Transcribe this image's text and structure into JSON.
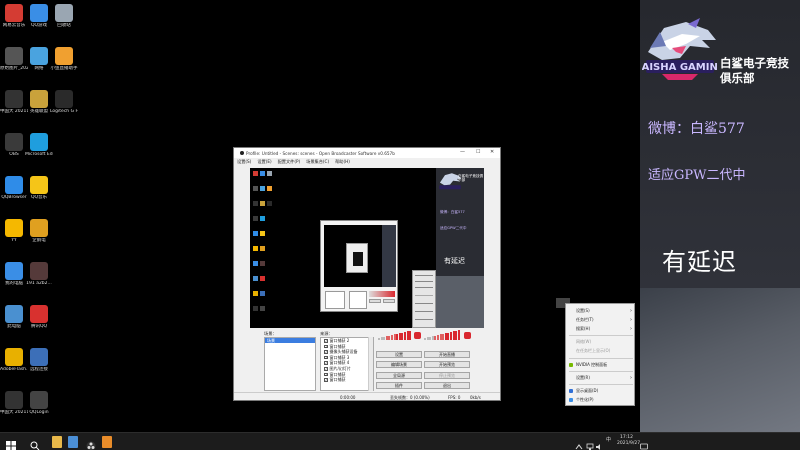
{
  "desktop": {
    "icons": [
      {
        "label": "网易云音乐",
        "color": "#d43c33",
        "col": 0,
        "row": 0
      },
      {
        "label": "QQ游戏",
        "color": "#3a8ee6",
        "col": 1,
        "row": 0
      },
      {
        "label": "回收站",
        "color": "#9aa6b2",
        "col": 2,
        "row": 0
      },
      {
        "label": "原始图片_20211...",
        "color": "#555",
        "col": 0,
        "row": 1
      },
      {
        "label": "网络",
        "color": "#4aa3df",
        "col": 1,
        "row": 1
      },
      {
        "label": "小鱼直播助手",
        "color": "#f0a030",
        "col": 2,
        "row": 1
      },
      {
        "label": "中国大 20211123...",
        "color": "#333",
        "col": 0,
        "row": 2
      },
      {
        "label": "英雄联盟",
        "color": "#c9a23b",
        "col": 1,
        "row": 2
      },
      {
        "label": "Logitech G HUB",
        "color": "#2a2a2a",
        "col": 2,
        "row": 2
      },
      {
        "label": "OBS",
        "color": "#3a3a3a",
        "col": 0,
        "row": 3
      },
      {
        "label": "Microsoft Edge",
        "color": "#1f9ede",
        "col": 1,
        "row": 3
      },
      {
        "label": "QQBrowser",
        "color": "#2f8ce8",
        "col": 0,
        "row": 4
      },
      {
        "label": "QQ音乐",
        "color": "#f5c518",
        "col": 1,
        "row": 4
      },
      {
        "label": "YY",
        "color": "#f5b800",
        "col": 0,
        "row": 5
      },
      {
        "label": "企鹅电",
        "color": "#e0a020",
        "col": 1,
        "row": 5
      },
      {
        "label": "我的电脑",
        "color": "#3a8ee6",
        "col": 0,
        "row": 6
      },
      {
        "label": "191 a2b2...",
        "color": "#553a3a",
        "col": 1,
        "row": 6
      },
      {
        "label": "此电脑",
        "color": "#4a90d0",
        "col": 0,
        "row": 7
      },
      {
        "label": "腾讯QQ",
        "color": "#d8312f",
        "col": 1,
        "row": 7
      },
      {
        "label": "AdobeFlash...",
        "color": "#e8b000",
        "col": 0,
        "row": 8
      },
      {
        "label": "远程连接",
        "color": "#3c6fb8",
        "col": 1,
        "row": 8
      },
      {
        "label": "中国大 20211020...",
        "color": "#333",
        "col": 0,
        "row": 9
      },
      {
        "label": "QQLogin",
        "color": "#444",
        "col": 1,
        "row": 9
      }
    ]
  },
  "overlay": {
    "club_name": "白鲨电子竞技俱乐部",
    "weibo": "微博：白鲨577",
    "adapt": "适应GPW二代中",
    "delay": "有延迟",
    "logo_text": "BAISHA GAMING"
  },
  "obs": {
    "title": "Profile: Untitled - Scenes: scenes - Open Broadcaster Software v0.657b",
    "menu": [
      "设置(S)",
      "设置(E)",
      "配置文件(P)",
      "场景集合(C)",
      "帮助(H)"
    ],
    "preview_delay": "有延迟",
    "scenes_label": "场景：",
    "sources_label": "来源：",
    "scene_selected": "场景",
    "sources": [
      "窗口捕获 2",
      "窗口捕获",
      "摄像头捕获设备",
      "窗口捕获 3",
      "窗口捕获 4",
      "图片/幻灯片",
      "窗口捕获",
      "窗口捕获"
    ],
    "buttons": {
      "settings": "设置",
      "start_stream": "开始直播",
      "edit_scene": "编辑场景",
      "start_preview": "开始预览",
      "global_sources": "全局源",
      "plugins": "插件",
      "exit": "退出",
      "studio_mode": "停止预览"
    },
    "status": {
      "time": "0:00:00",
      "dropped": "丢失帧数：0 (0.00%)",
      "fps": "FPS: 0",
      "kbps": "0kb/s"
    }
  },
  "context_menu": {
    "items": [
      {
        "label": "设置(S)",
        "type": "submenu",
        "enabled": true
      },
      {
        "label": "任务栏(T)",
        "type": "submenu",
        "enabled": true
      },
      {
        "label": "搜索(H)",
        "type": "submenu",
        "enabled": true
      },
      {
        "label": "网络(W)",
        "type": "item",
        "enabled": false
      },
      {
        "label": "在任务栏上显示(O)",
        "type": "item",
        "enabled": false
      },
      {
        "label": "NVIDIA 控制面板",
        "type": "item",
        "enabled": true
      },
      {
        "label": "设置(R)",
        "type": "submenu",
        "enabled": true
      },
      {
        "label": "显示桌面(D)",
        "type": "item",
        "enabled": true
      },
      {
        "label": "个性化(P)",
        "type": "item",
        "enabled": true
      }
    ]
  },
  "taskbar": {
    "clock_time": "17:12",
    "clock_date": "2021/9/27",
    "ime": "中"
  },
  "colors": {
    "accent_purple": "#c9b7ff",
    "obs_volume_red": "#d9282f",
    "selection_blue": "#3b7de0"
  }
}
